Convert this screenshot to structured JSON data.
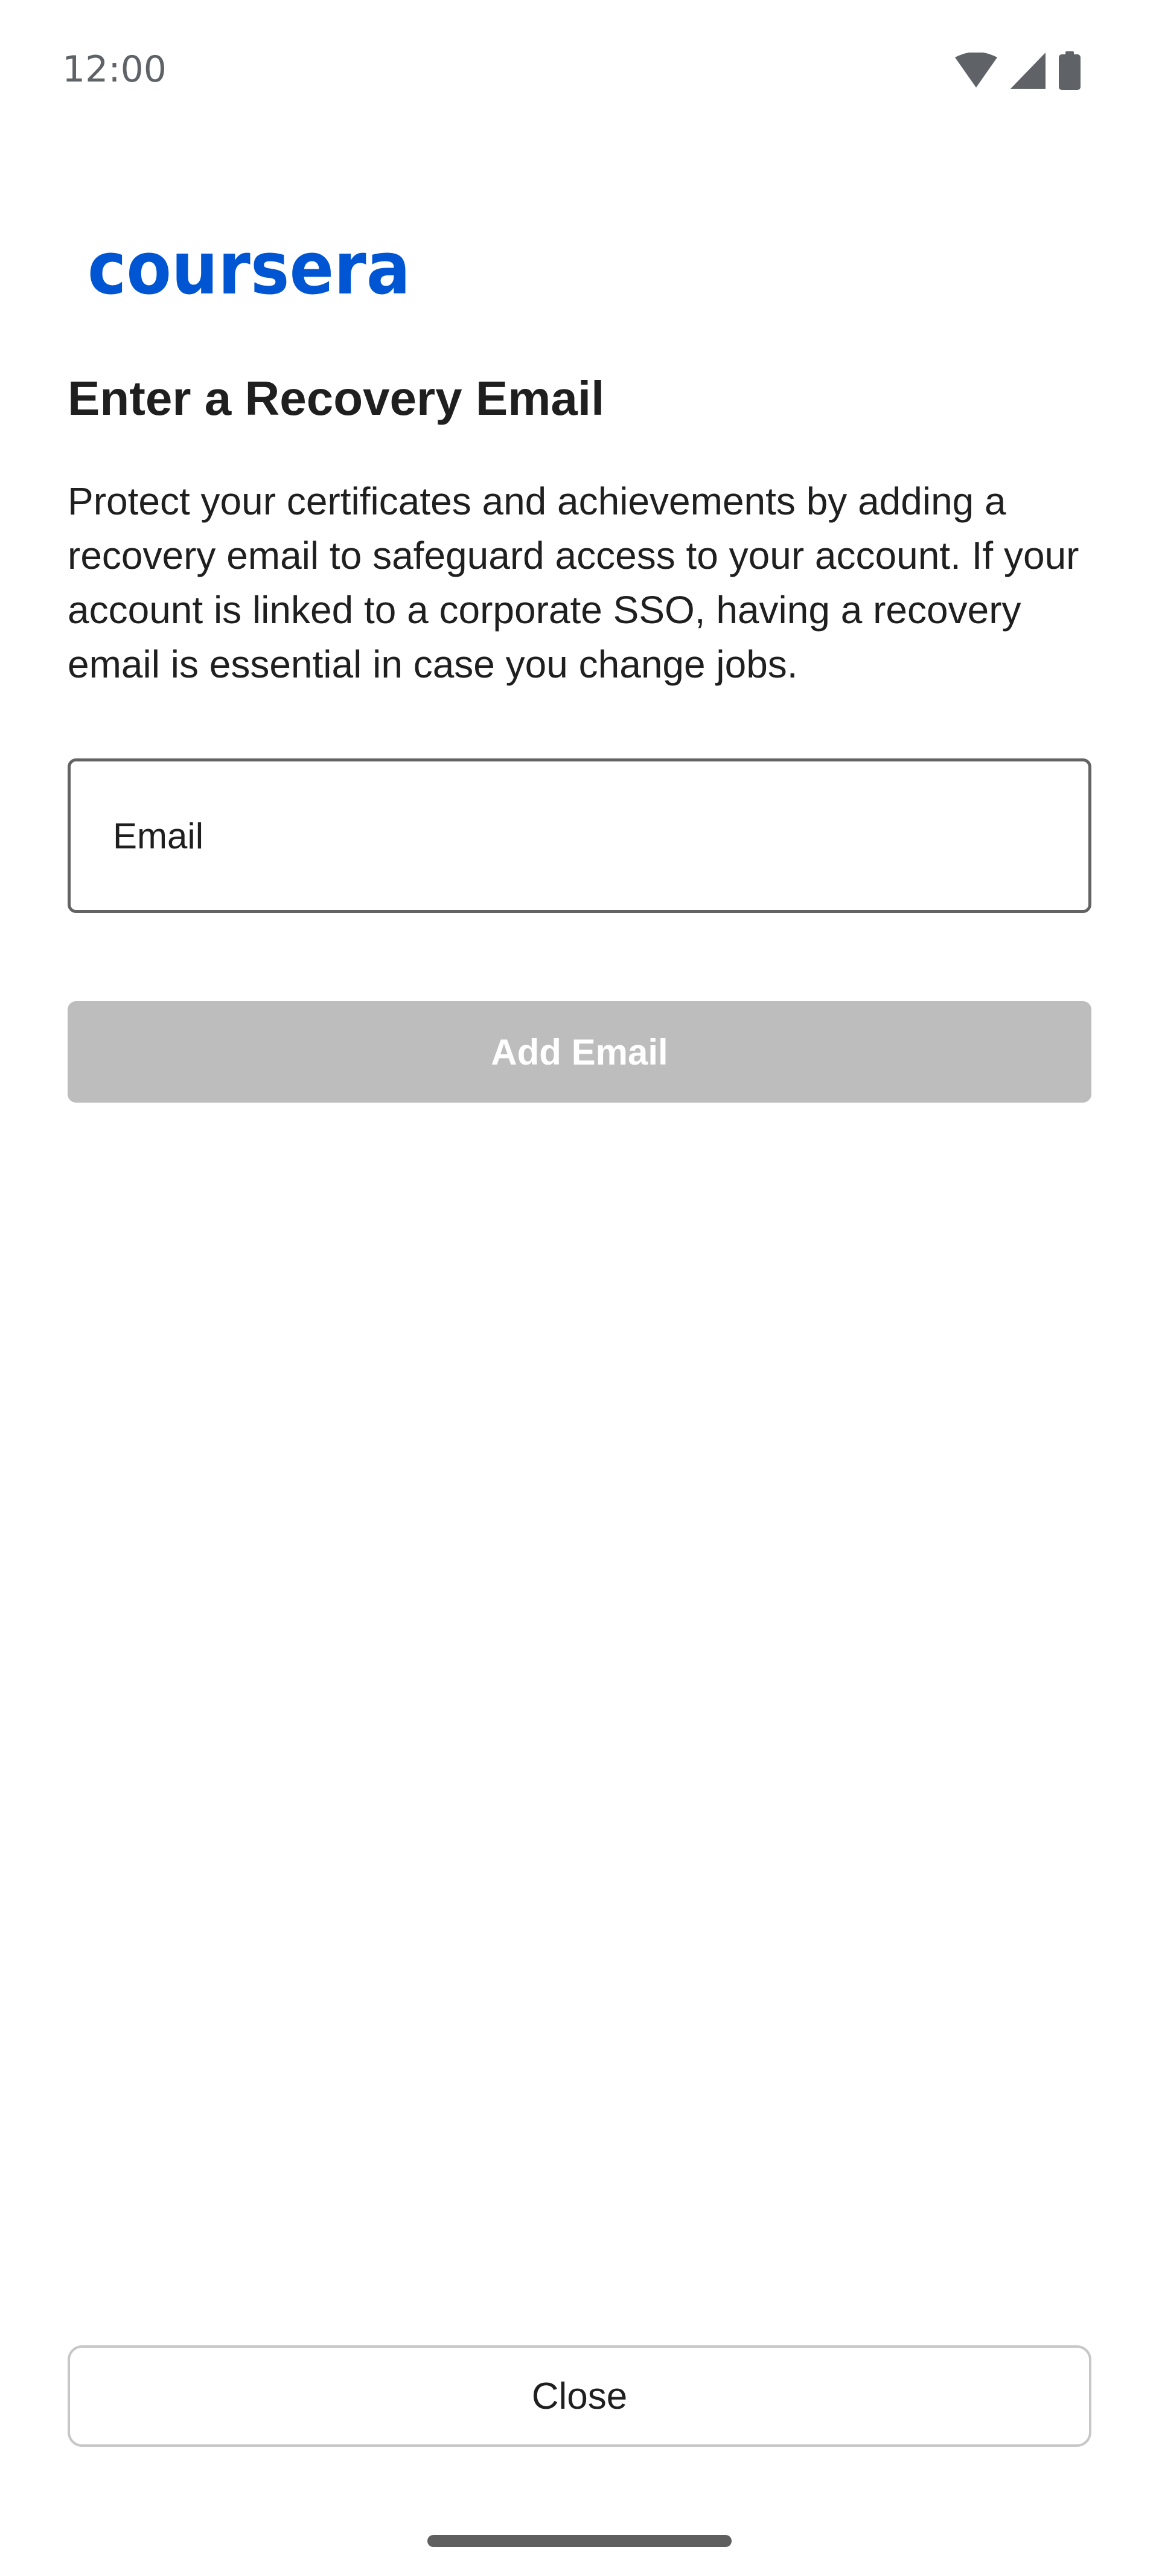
{
  "status_bar": {
    "time": "12:00",
    "icons": [
      "wifi-icon",
      "signal-icon",
      "battery-icon"
    ]
  },
  "logo": {
    "text": "coursera",
    "color": "#0056d2"
  },
  "title": "Enter a Recovery Email",
  "description": "Protect your certificates and achievements by adding a recovery email to safeguard access to your account. If your account is linked to a corporate SSO, having a recovery email is essential in case you change jobs.",
  "email_field": {
    "placeholder": "Email",
    "value": ""
  },
  "add_button": {
    "label": "Add Email",
    "state": "disabled",
    "color": "#bdbdbd"
  },
  "close_button": {
    "label": "Close"
  }
}
